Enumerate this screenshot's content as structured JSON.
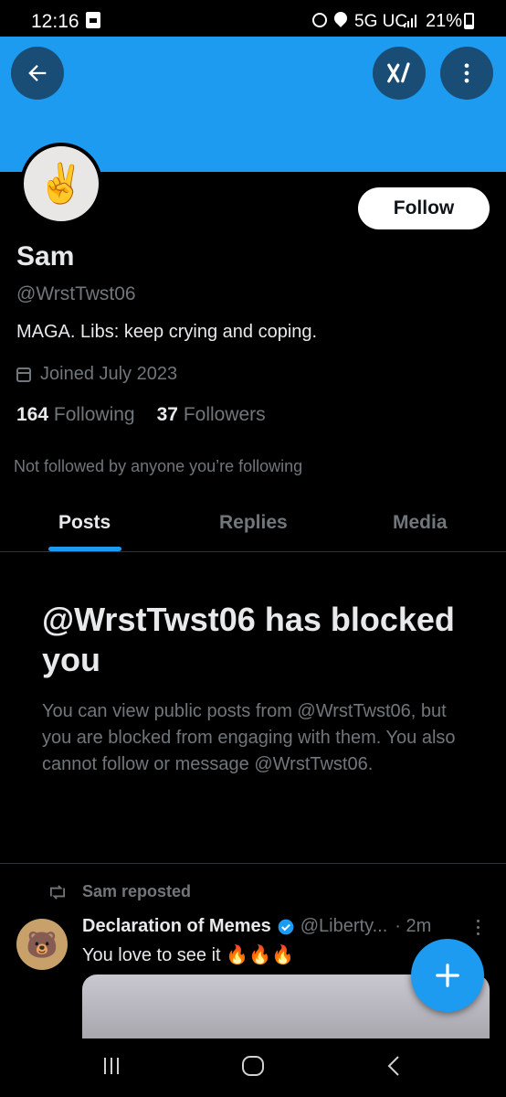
{
  "status_bar": {
    "time": "12:16",
    "network": "5G UC",
    "battery": "21%"
  },
  "profile": {
    "avatar_emoji": "✌️",
    "follow_label": "Follow",
    "name": "Sam",
    "handle": "@WrstTwst06",
    "bio": "MAGA. Libs: keep crying and coping.",
    "joined": "Joined July 2023",
    "following_count": "164",
    "following_label": "Following",
    "followers_count": "37",
    "followers_label": "Followers",
    "not_followed": "Not followed by anyone you’re following"
  },
  "tabs": [
    {
      "label": "Posts",
      "active": true
    },
    {
      "label": "Replies",
      "active": false
    },
    {
      "label": "Media",
      "active": false
    }
  ],
  "blocked": {
    "title": "@WrstTwst06 has blocked you",
    "body": "You can view public posts from @WrstTwst06, but you are blocked from engaging with them. You also cannot follow or message @WrstTwst06."
  },
  "post": {
    "repost_label": "Sam reposted",
    "author": "Declaration of Memes",
    "handle": "@Liberty...",
    "time": "· 2m",
    "text": "You love to see it 🔥🔥🔥",
    "avatar_emoji": "🐻"
  },
  "colors": {
    "accent": "#1d9bf0",
    "background": "#000000",
    "secondary_text": "#71767b",
    "primary_text": "#e7e9ea"
  },
  "icons": {
    "back": "arrow-left-icon",
    "grok": "grok-icon",
    "more": "more-vertical-icon",
    "calendar": "calendar-icon",
    "repost": "repost-icon",
    "verified": "verified-badge-icon",
    "compose": "plus-icon"
  }
}
